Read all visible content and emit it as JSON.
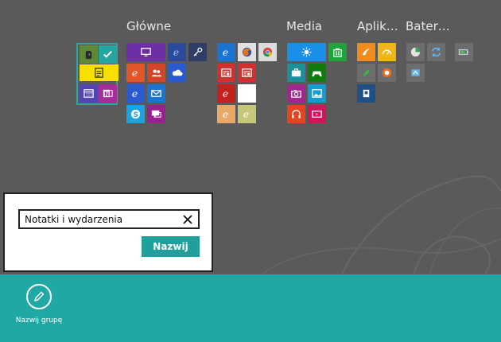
{
  "groups": [
    {
      "title": "Główne"
    },
    {
      "title": "Media"
    },
    {
      "title": "Aplik…"
    },
    {
      "title": "Bater…"
    }
  ],
  "rename_dialog": {
    "input_value": "Notatki i wydarzenia",
    "confirm_label": "Nazwij"
  },
  "app_bar": {
    "rename_group_label": "Nazwij grupę"
  },
  "colors": {
    "accent": "#20a9a4",
    "start_background": "#5a5a5a"
  }
}
